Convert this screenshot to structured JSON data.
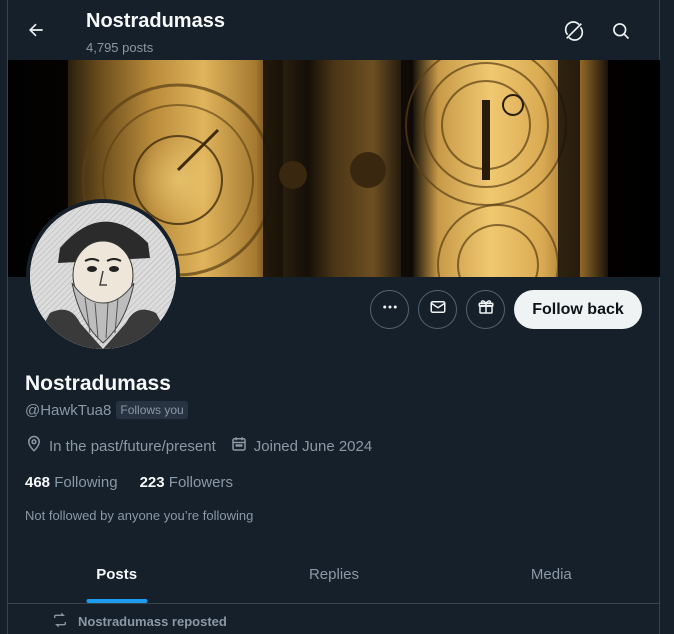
{
  "header": {
    "title": "Nostradumass",
    "posts_count": "4,795 posts",
    "icons": [
      "back-arrow-icon",
      "sync-icon",
      "search-icon"
    ]
  },
  "profile": {
    "name": "Nostradumass",
    "handle": "@HawkTua8",
    "follows_you": "Follows you",
    "location": "In the past/future/present",
    "joined": "Joined June 2024",
    "following_count": "468",
    "following_label": "Following",
    "followers_count": "223",
    "followers_label": "Followers",
    "not_followed": "Not followed by anyone you’re following"
  },
  "actions": {
    "follow_back": "Follow back",
    "icons": [
      "more-icon",
      "message-icon",
      "gift-icon"
    ]
  },
  "tabs": [
    {
      "label": "Posts",
      "active": true
    },
    {
      "label": "Replies",
      "active": false
    },
    {
      "label": "Media",
      "active": false
    }
  ],
  "feed": {
    "repost_label": "Nostradumass reposted"
  },
  "colors": {
    "background": "#15202b",
    "accent": "#1d9bf0",
    "muted_text": "#8b98a5",
    "primary_text": "#f7f9f9"
  }
}
